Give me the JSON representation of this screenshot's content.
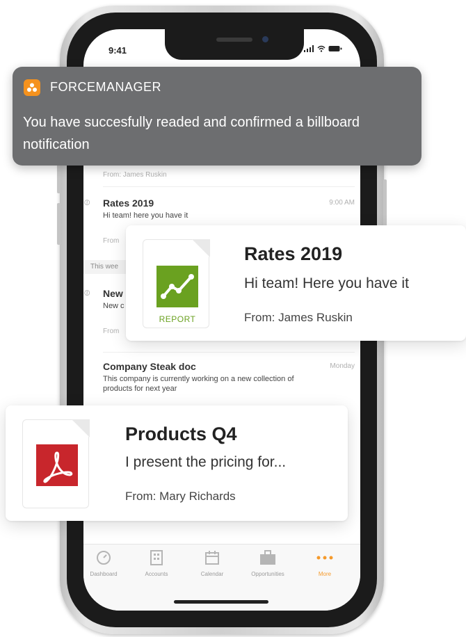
{
  "status_bar": {
    "time": "9:41",
    "icons": "..ıl ᯤ ▬"
  },
  "notification": {
    "app_name": "FORCEMANAGER",
    "message": "You have succesfully readed and confirmed a billboard notification"
  },
  "list": {
    "items": [
      {
        "from": "From: James Ruskin"
      },
      {
        "title": "Rates 2019",
        "time": "9:00 AM",
        "preview": "Hi team! here you have it",
        "from": "From"
      },
      {
        "title": "New",
        "preview": "New c",
        "from": "From"
      },
      {
        "title": "Company Steak doc",
        "time": "Monday",
        "preview": "This company is currently working on a new collection of products for next year"
      }
    ],
    "section_label": "This wee"
  },
  "card_rates": {
    "title": "Rates 2019",
    "subtitle": "Hi team! Here you have it",
    "from": "From: James Ruskin",
    "file_label": "REPORT",
    "file_color": "#6aa120"
  },
  "card_products": {
    "title": "Products Q4",
    "subtitle": "I present the pricing for...",
    "from": "From: Mary Richards",
    "file_color": "#c8262c"
  },
  "tabbar": {
    "tabs": [
      {
        "label": "Dashboard",
        "icon": "dashboard-icon"
      },
      {
        "label": "Accounts",
        "icon": "accounts-icon"
      },
      {
        "label": "Calendar",
        "icon": "calendar-icon"
      },
      {
        "label": "Opportunities",
        "icon": "briefcase-icon"
      },
      {
        "label": "More",
        "icon": "more-icon",
        "active": true
      }
    ]
  },
  "colors": {
    "accent": "#f59a2b",
    "banner_bg": "#6d6e70"
  }
}
